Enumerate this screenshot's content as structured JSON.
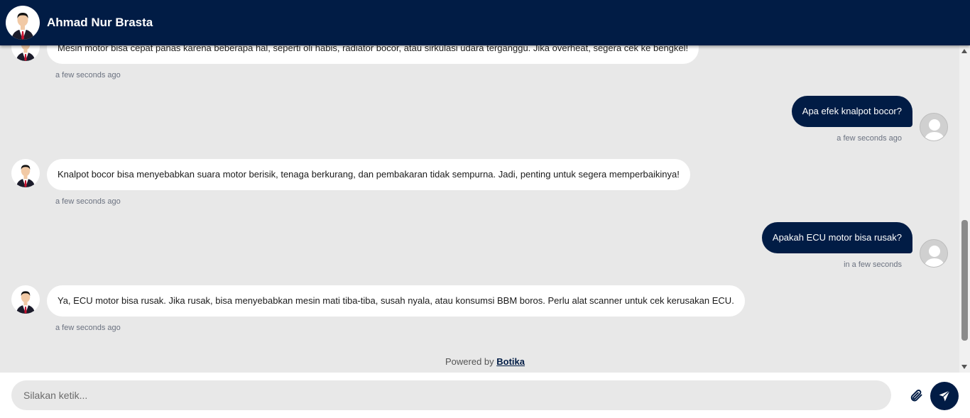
{
  "header": {
    "title": "Ahmad Nur Brasta",
    "avatar_icon": "bot-avatar-man-suit"
  },
  "messages": [
    {
      "from": "bot",
      "text": "Mesin motor bisa cepat panas karena beberapa hal, seperti oli habis, radiator bocor, atau sirkulasi udara terganggu. Jika overheat, segera cek ke bengkel!",
      "time": "a few seconds ago"
    },
    {
      "from": "user",
      "text": "Apa efek knalpot bocor?",
      "time": "a few seconds ago"
    },
    {
      "from": "bot",
      "text": "Knalpot bocor bisa menyebabkan suara motor berisik, tenaga berkurang, dan pembakaran tidak sempurna. Jadi, penting untuk segera memperbaikinya!",
      "time": "a few seconds ago"
    },
    {
      "from": "user",
      "text": "Apakah ECU motor bisa rusak?",
      "time": "in a few seconds"
    },
    {
      "from": "bot",
      "text": "Ya, ECU motor bisa rusak. Jika rusak, bisa menyebabkan mesin mati tiba-tiba, susah nyala, atau konsumsi BBM boros. Perlu alat scanner untuk cek kerusakan ECU.",
      "time": "a few seconds ago"
    }
  ],
  "footer": {
    "powered_prefix": "Powered by",
    "powered_link": "Botika"
  },
  "input": {
    "placeholder": "Silakan ketik...",
    "value": ""
  },
  "icons": {
    "attach": "paperclip-icon",
    "send": "paper-plane-icon"
  },
  "colors": {
    "brand": "#011c45",
    "chat_bg": "#e8e8e8",
    "bot_bubble": "#ffffff"
  }
}
